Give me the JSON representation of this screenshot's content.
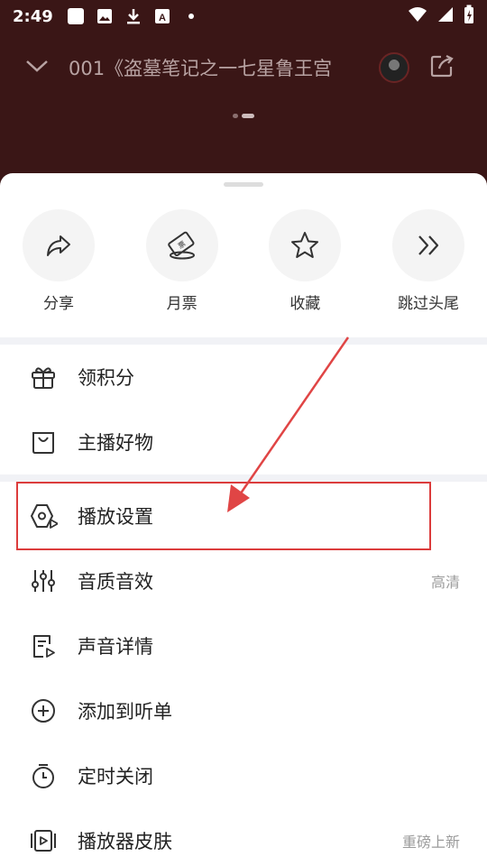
{
  "status_bar": {
    "time": "2:49"
  },
  "player": {
    "title": "001《盗墓笔记之一七星鲁王宫"
  },
  "quick_actions": [
    {
      "label": "分享",
      "icon": "share-icon"
    },
    {
      "label": "月票",
      "icon": "ticket-icon"
    },
    {
      "label": "收藏",
      "icon": "star-icon"
    },
    {
      "label": "跳过头尾",
      "icon": "skip-icon"
    }
  ],
  "menu": {
    "points": {
      "label": "领积分",
      "icon": "gift-icon"
    },
    "goods": {
      "label": "主播好物",
      "icon": "bag-icon"
    },
    "play_settings": {
      "label": "播放设置",
      "icon": "play-settings-icon"
    },
    "audio_quality": {
      "label": "音质音效",
      "extra": "高清",
      "icon": "equalizer-icon"
    },
    "sound_details": {
      "label": "声音详情",
      "icon": "document-play-icon"
    },
    "add_to_list": {
      "label": "添加到听单",
      "icon": "plus-circle-icon"
    },
    "timer_close": {
      "label": "定时关闭",
      "icon": "timer-icon"
    },
    "player_skin": {
      "label": "播放器皮肤",
      "extra": "重磅上新",
      "icon": "skin-icon"
    }
  },
  "colors": {
    "header_bg": "#3a1616",
    "annotation_red": "#dc3c3c",
    "sheet_bg": "#ffffff",
    "divider": "#f1f2f6"
  }
}
